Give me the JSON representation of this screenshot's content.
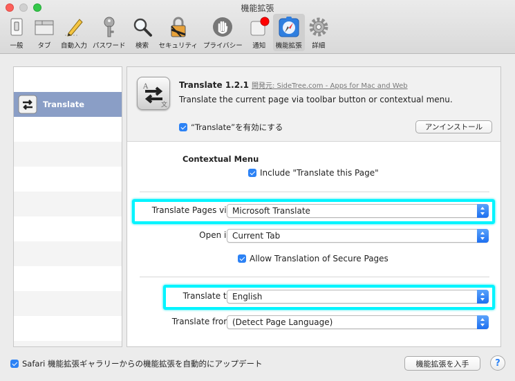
{
  "window": {
    "title": "機能拡張"
  },
  "toolbar": {
    "items": [
      {
        "label": "一般",
        "icon": "general-switch-icon"
      },
      {
        "label": "タブ",
        "icon": "tabs-icon"
      },
      {
        "label": "自動入力",
        "icon": "autofill-pencil-icon"
      },
      {
        "label": "パスワード",
        "icon": "key-icon"
      },
      {
        "label": "検索",
        "icon": "magnifier-icon"
      },
      {
        "label": "セキュリティ",
        "icon": "padlock-icon"
      },
      {
        "label": "プライバシー",
        "icon": "hand-icon"
      },
      {
        "label": "通知",
        "icon": "notification-badge-icon"
      },
      {
        "label": "機能拡張",
        "icon": "extensions-icon",
        "selected": true
      },
      {
        "label": "詳細",
        "icon": "gear-icon"
      }
    ]
  },
  "sidebar": {
    "items": [
      {
        "label": "Translate",
        "selected": true
      }
    ]
  },
  "extension": {
    "name": "Translate 1.2.1",
    "developer": "開発元: SideTree.com - Apps for Mac and Web",
    "description": "Translate the current page via toolbar button or contextual menu.",
    "enable_label": "“Translate”を有効にする",
    "uninstall_label": "アンインストール"
  },
  "settings": {
    "contextual_menu_title": "Contextual Menu",
    "include_label": "Include \"Translate this Page\"",
    "translate_via_label": "Translate Pages via:",
    "translate_via_value": "Microsoft Translate",
    "open_in_label": "Open in:",
    "open_in_value": "Current Tab",
    "secure_label": "Allow Translation of Secure Pages",
    "translate_to_label": "Translate to:",
    "translate_to_value": "English",
    "translate_from_label": "Translate from:",
    "translate_from_value": "(Detect Page Language)"
  },
  "footer": {
    "auto_update_label": "Safari 機能拡張ギャラリーからの機能拡張を自動的にアップデート",
    "get_extensions_label": "機能拡張を入手",
    "help_label": "?"
  },
  "colors": {
    "highlight": "#00f4ff",
    "selection": "#8a9ec6",
    "accent": "#2c82f5"
  }
}
